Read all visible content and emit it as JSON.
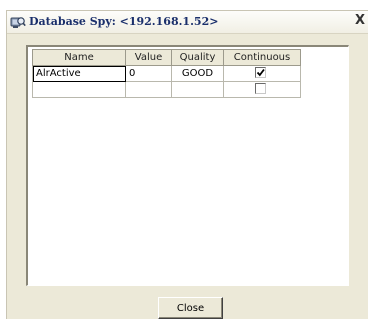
{
  "window": {
    "title": "Database Spy: <192.168.1.52>",
    "close_glyph": "X",
    "icon": "database-spy-icon"
  },
  "grid": {
    "columns": [
      "Name",
      "Value",
      "Quality",
      "Continuous"
    ],
    "rows": [
      {
        "name": "AlrActive",
        "value": "0",
        "quality": "GOOD",
        "continuous": true
      },
      {
        "name": "",
        "value": "",
        "quality": "",
        "continuous": false
      }
    ]
  },
  "buttons": {
    "close_label": "Close"
  },
  "colors": {
    "dialog_background": "#ece9d8",
    "title_text": "#1a2f6b"
  }
}
